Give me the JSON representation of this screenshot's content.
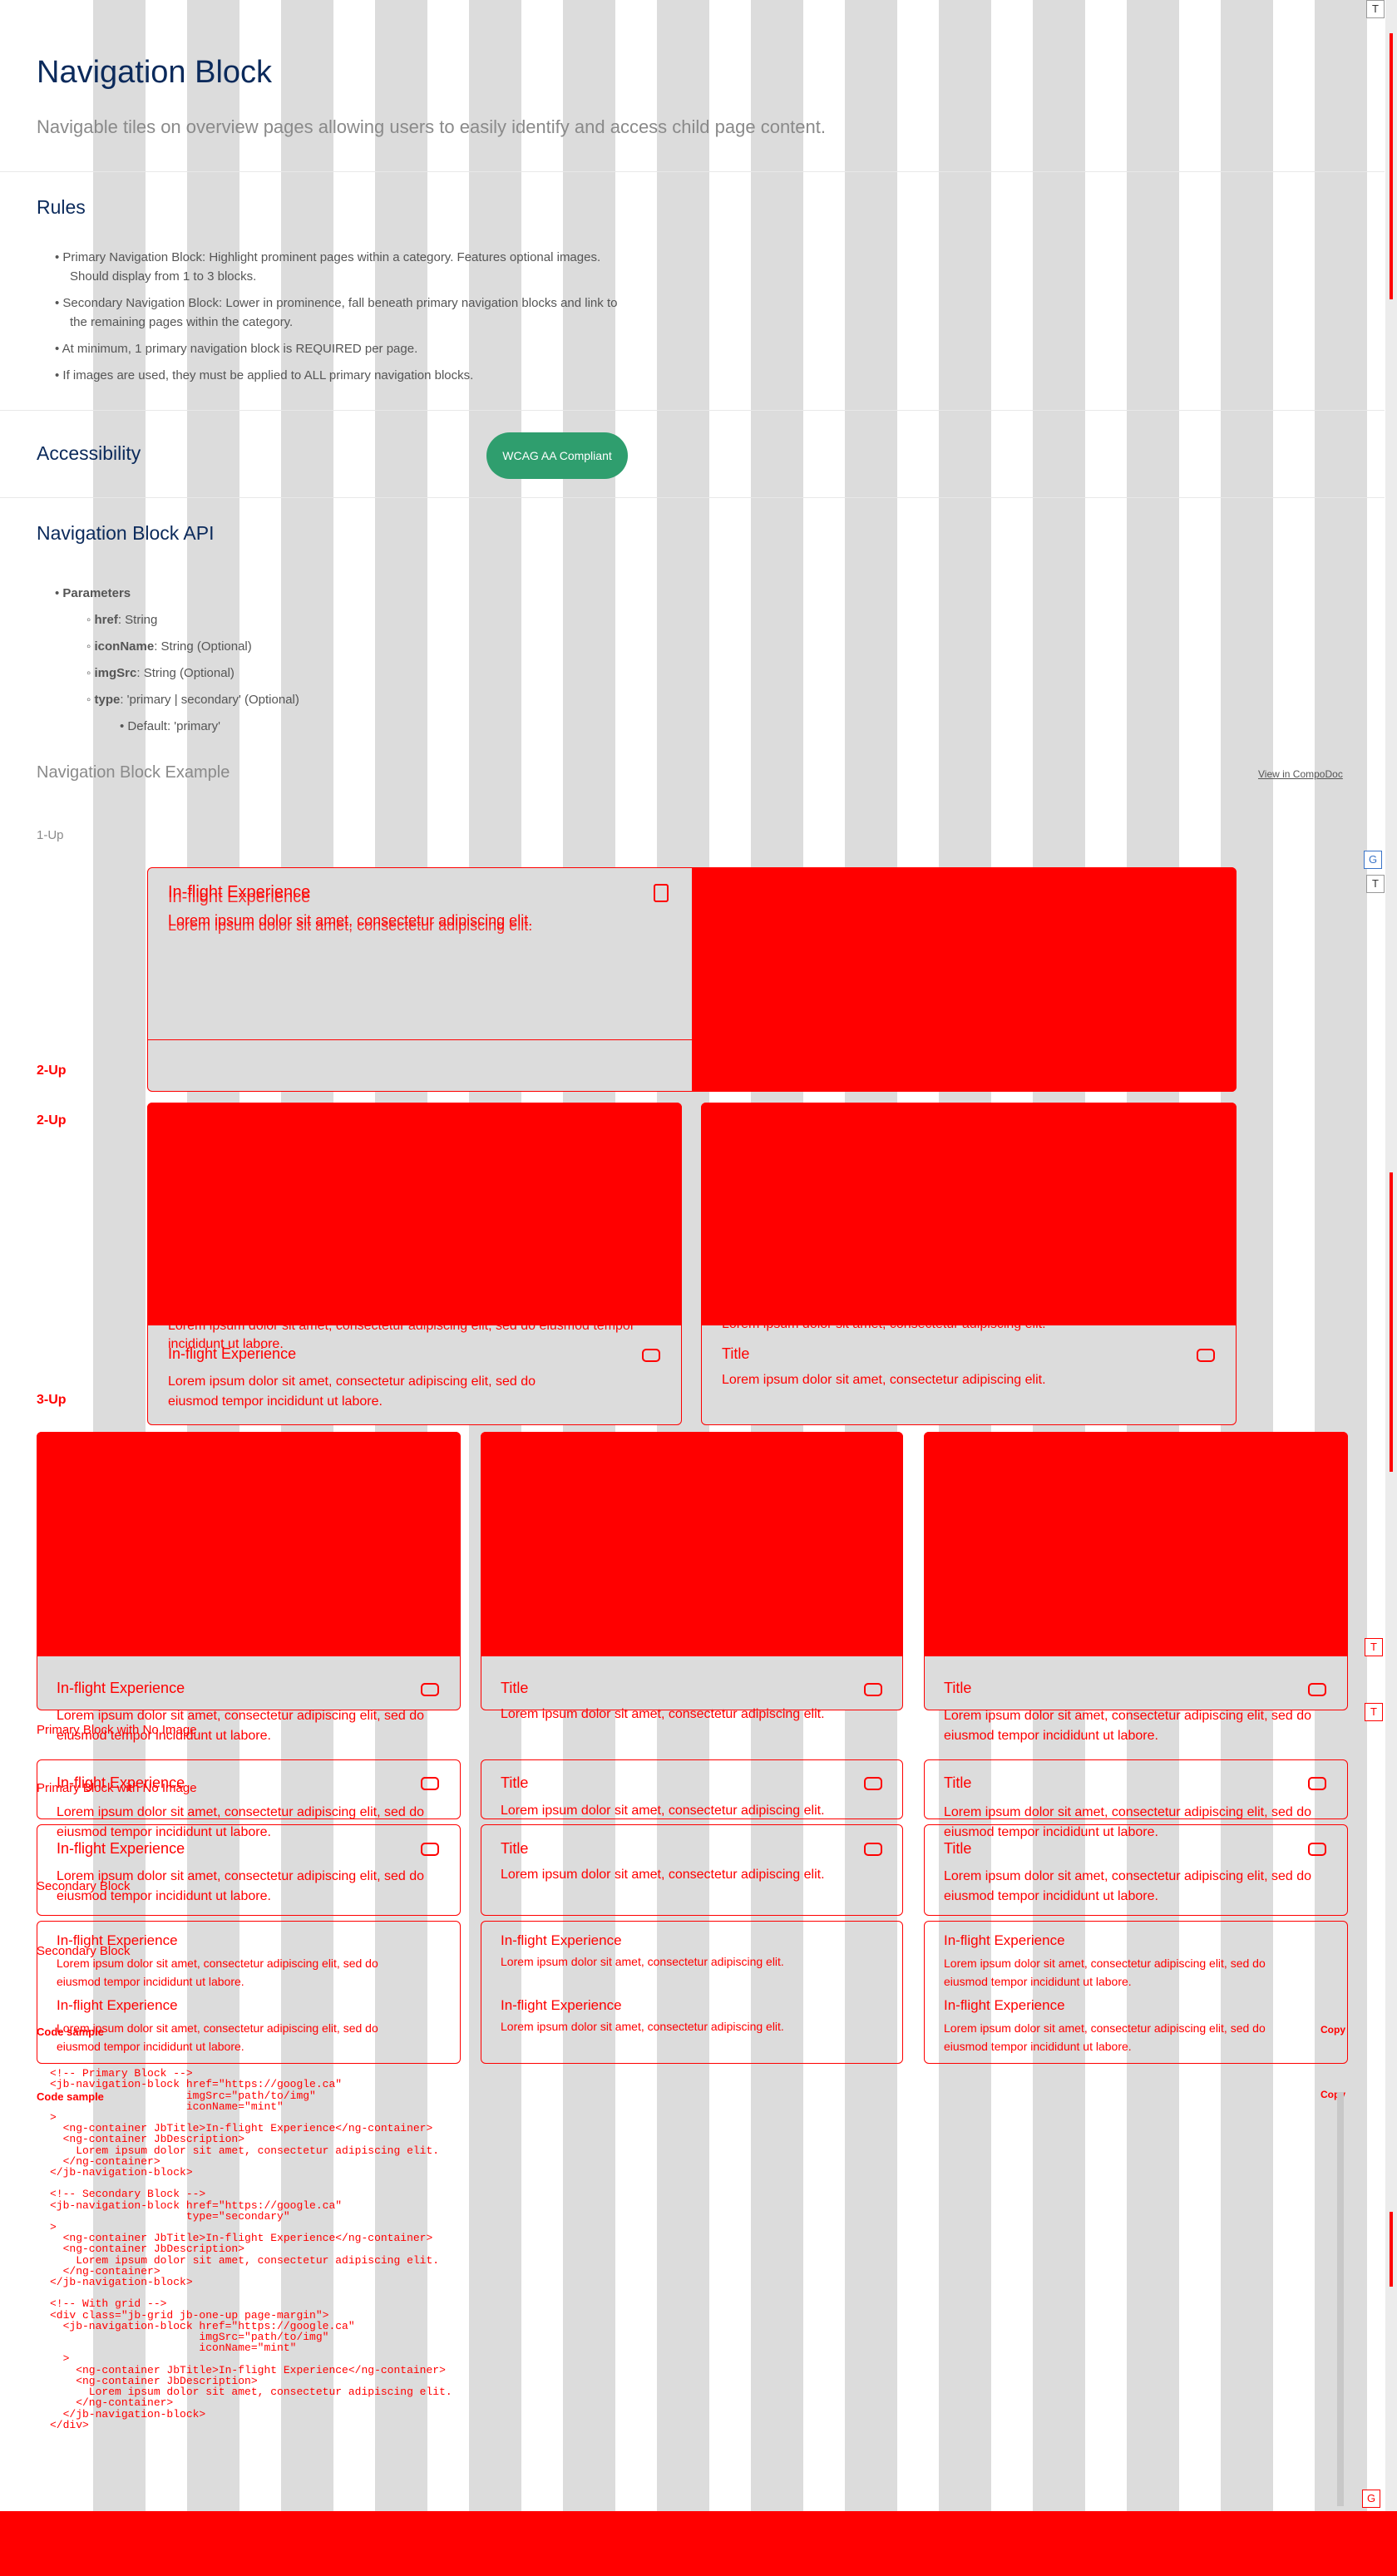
{
  "header": {
    "title": "Navigation Block",
    "subtitle": "Navigable tiles on overview pages allowing users to easily identify and access child page content."
  },
  "rules": {
    "heading": "Rules",
    "items": [
      "Primary Navigation Block: Highlight prominent pages within a category. Features optional images.",
      "Should display from 1 to 3 blocks.",
      "Secondary Navigation Block: Lower in prominence, fall beneath primary navigation blocks and link to",
      "the remaining pages within the category.",
      "At minimum, 1 primary navigation block is REQUIRED per page.",
      "If images are used, they must be applied to ALL primary navigation blocks."
    ]
  },
  "accessibility": {
    "heading": "Accessibility",
    "badge": "WCAG AA Compliant"
  },
  "api": {
    "heading": "Navigation Block API",
    "parameters_label": "Parameters",
    "params": [
      {
        "name": "href",
        "desc": ": String"
      },
      {
        "name": "iconName",
        "desc": ": String (Optional)"
      },
      {
        "name": "imgSrc",
        "desc": ": String (Optional)"
      },
      {
        "name": "type",
        "desc": ": 'primary | secondary' (Optional)"
      }
    ],
    "default": "Default: 'primary'"
  },
  "example": {
    "heading": "Navigation Block Example",
    "link": "View in CompoDoc",
    "label_1up": "1-Up",
    "label_2up_a": "2-Up",
    "label_2up_b": "2-Up",
    "label_3up": "3-Up",
    "label_primary_no_image_a": "Primary Block with No Image",
    "label_primary_no_image_b": "Primary Block with No Image",
    "label_secondary_a": "Secondary Block",
    "label_secondary_b": "Secondary Block",
    "label_code_a": "Code sample",
    "label_code_b": "Code sample",
    "copy_a": "Copy",
    "copy_b": "Copy"
  },
  "cards": {
    "title_a": "In-flight Experience",
    "title_b": "Title",
    "desc_short": "Lorem ipsum dolor sit amet, consectetur adipiscing elit.",
    "desc_long_1": "Lorem ipsum dolor sit amet, consectetur adipiscing elit, sed do",
    "desc_long_2": "eiusmod tempor incididunt ut labore.",
    "desc_long_full": "Lorem ipsum dolor sit amet, consectetur adipiscing elit, sed do eiusmod tempor incididunt ut labore."
  },
  "code": {
    "lines": [
      "<!-- Primary Block -->",
      "<jb-navigation-block href=\"https://google.ca\"",
      "                     imgSrc=\"path/to/img\"",
      "                     iconName=\"mint\"",
      ">",
      "  <ng-container JbTitle>In-flight Experience</ng-container>",
      "  <ng-container JbDescription>",
      "    Lorem ipsum dolor sit amet, consectetur adipiscing elit.",
      "  </ng-container>",
      "</jb-navigation-block>",
      "",
      "<!-- Secondary Block -->",
      "<jb-navigation-block href=\"https://google.ca\"",
      "                     type=\"secondary\"",
      ">",
      "  <ng-container JbTitle>In-flight Experience</ng-container>",
      "  <ng-container JbDescription>",
      "    Lorem ipsum dolor sit amet, consectetur adipiscing elit.",
      "  </ng-container>",
      "</jb-navigation-block>",
      "",
      "<!-- With grid -->",
      "<div class=\"jb-grid jb-one-up page-margin\">",
      "  <jb-navigation-block href=\"https://google.ca\"",
      "                       imgSrc=\"path/to/img\"",
      "                       iconName=\"mint\"",
      "  >",
      "    <ng-container JbTitle>In-flight Experience</ng-container>",
      "    <ng-container JbDescription>",
      "      Lorem ipsum dolor sit amet, consectetur adipiscing elit.",
      "    </ng-container>",
      "  </jb-navigation-block>",
      "</div>"
    ]
  },
  "side_buttons": {
    "t": "T",
    "g": "G"
  },
  "colors": {
    "navy": "#0b2a5b",
    "green_badge": "#2f9e6e",
    "highlight_red": "#ff0000",
    "grid_gray": "#dcdcdc"
  }
}
